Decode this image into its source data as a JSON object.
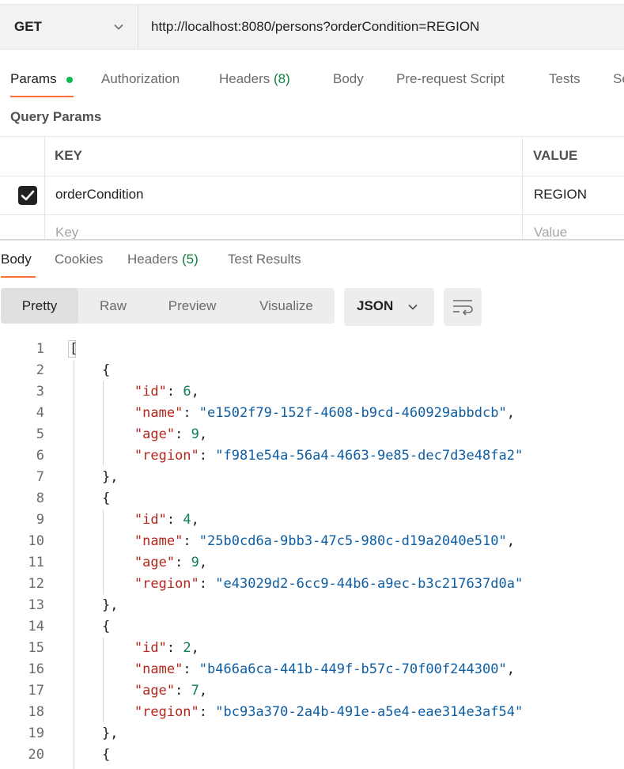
{
  "request": {
    "method": "GET",
    "url": "http://localhost:8080/persons?orderCondition=REGION"
  },
  "request_tabs": {
    "params": "Params",
    "authorization": "Authorization",
    "headers": "Headers",
    "headers_count": "(8)",
    "body": "Body",
    "pre_request": "Pre-request Script",
    "tests": "Tests",
    "settings_clipped": "Se"
  },
  "query_params": {
    "title": "Query Params",
    "key_header": "KEY",
    "value_header": "VALUE",
    "rows": [
      {
        "checked": true,
        "key": "orderCondition",
        "value": "REGION"
      }
    ],
    "key_placeholder": "Key",
    "value_placeholder": "Value"
  },
  "response_tabs": {
    "body": "Body",
    "cookies": "Cookies",
    "headers": "Headers",
    "headers_count": "(5)",
    "test_results": "Test Results"
  },
  "view_modes": {
    "pretty": "Pretty",
    "raw": "Raw",
    "preview": "Preview",
    "visualize": "Visualize"
  },
  "format": "JSON",
  "code": {
    "line_numbers": [
      "1",
      "2",
      "3",
      "4",
      "5",
      "6",
      "7",
      "8",
      "9",
      "10",
      "11",
      "12",
      "13",
      "14",
      "15",
      "16",
      "17",
      "18",
      "19",
      "20"
    ],
    "open_array": "[",
    "open_obj": "{",
    "close_obj": "},",
    "key_id": "\"id\"",
    "key_name": "\"name\"",
    "key_age": "\"age\"",
    "key_region": "\"region\"",
    "colon": ": ",
    "comma": ",",
    "objects": [
      {
        "id": "6",
        "name": "\"e1502f79-152f-4608-b9cd-460929abbdcb\"",
        "age": "9",
        "region": "\"f981e54a-56a4-4663-9e85-dec7d3e48fa2\""
      },
      {
        "id": "4",
        "name": "\"25b0cd6a-9bb3-47c5-980c-d19a2040e510\"",
        "age": "9",
        "region": "\"e43029d2-6cc9-44b6-a9ec-b3c217637d0a\""
      },
      {
        "id": "2",
        "name": "\"b466a6ca-441b-449f-b57c-70f00f244300\"",
        "age": "7",
        "region": "\"bc93a370-2a4b-491e-a5e4-eae314e3af54\""
      }
    ]
  },
  "colors": {
    "accent": "#ff6c37",
    "active_dot": "#0cbb52",
    "json_key": "#b5271c",
    "json_string": "#0e5ea3",
    "json_number": "#0f7d58"
  }
}
